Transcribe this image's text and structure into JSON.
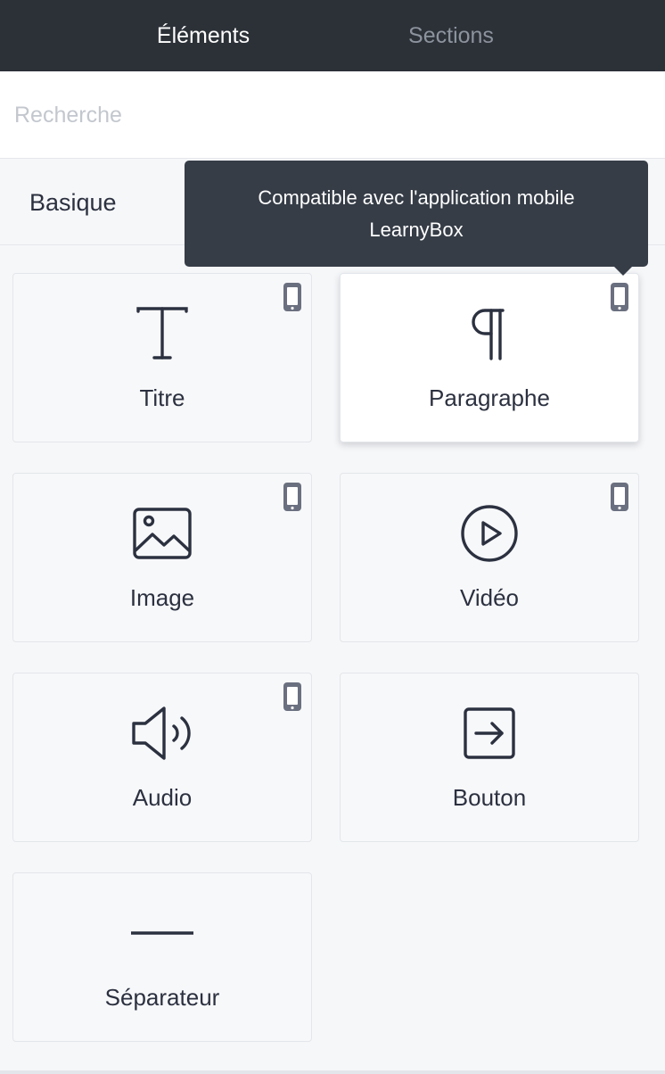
{
  "tabs": {
    "elements": "Éléments",
    "sections": "Sections"
  },
  "search": {
    "placeholder": "Recherche"
  },
  "section": {
    "title": "Basique"
  },
  "tooltip": {
    "line1": "Compatible avec l'application mobile",
    "line2": "LearnyBox"
  },
  "elements": [
    {
      "label": "Titre",
      "icon": "title-icon",
      "mobile": true
    },
    {
      "label": "Paragraphe",
      "icon": "paragraph-icon",
      "mobile": true
    },
    {
      "label": "Image",
      "icon": "image-icon",
      "mobile": true
    },
    {
      "label": "Vidéo",
      "icon": "video-icon",
      "mobile": true
    },
    {
      "label": "Audio",
      "icon": "audio-icon",
      "mobile": true
    },
    {
      "label": "Bouton",
      "icon": "button-icon",
      "mobile": false
    },
    {
      "label": "Séparateur",
      "icon": "separator-icon",
      "mobile": false
    }
  ],
  "colors": {
    "topbar": "#2c3138",
    "tooltip": "#363d47",
    "mobile_icon": "#6b7080",
    "text": "#2c3140"
  }
}
